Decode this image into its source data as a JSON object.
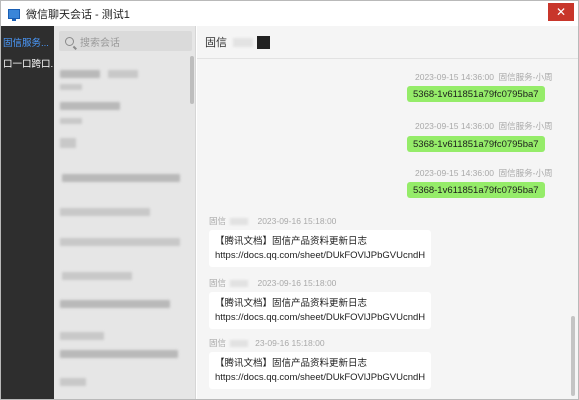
{
  "window": {
    "title": "微信聊天会话 - 测试1",
    "close_label": "✕"
  },
  "nav": {
    "items": [
      {
        "label": "固信服务..."
      },
      {
        "label": "口一口跨口..."
      }
    ],
    "active_color": "#4b9bff"
  },
  "search": {
    "placeholder": "搜索会话"
  },
  "chat": {
    "title": "固信",
    "messages": [
      {
        "direction": "out",
        "timestamp": "2023-09-15 14:36:00",
        "sender": "固信服务-小周",
        "text": "5368-1v611851a79fc0795ba7"
      },
      {
        "direction": "out",
        "timestamp": "2023-09-15 14:36:00",
        "sender": "固信服务-小周",
        "text": "5368-1v611851a79fc0795ba7"
      },
      {
        "direction": "out",
        "timestamp": "2023-09-15 14:36:00",
        "sender": "固信服务-小周",
        "text": "5368-1v611851a79fc0795ba7"
      },
      {
        "direction": "in",
        "sender": "固信",
        "timestamp": "2023-09-16 15:18:00",
        "line1": "【腾讯文档】固信产品资料更新日志",
        "line2": "https://docs.qq.com/sheet/DUkFOVlJPbGVUcndH"
      },
      {
        "direction": "in",
        "sender": "固信",
        "timestamp": "2023-09-16 15:18:00",
        "line1": "【腾讯文档】固信产品资料更新日志",
        "line2": "https://docs.qq.com/sheet/DUkFOVlJPbGVUcndH"
      },
      {
        "direction": "in",
        "sender": "固信",
        "timestamp": "23-09-16 15:18:00",
        "line1": "【腾讯文档】固信产品资料更新日志",
        "line2": "https://docs.qq.com/sheet/DUkFOVlJPbGVUcndH"
      }
    ],
    "bubble_color": "#95ec69"
  }
}
